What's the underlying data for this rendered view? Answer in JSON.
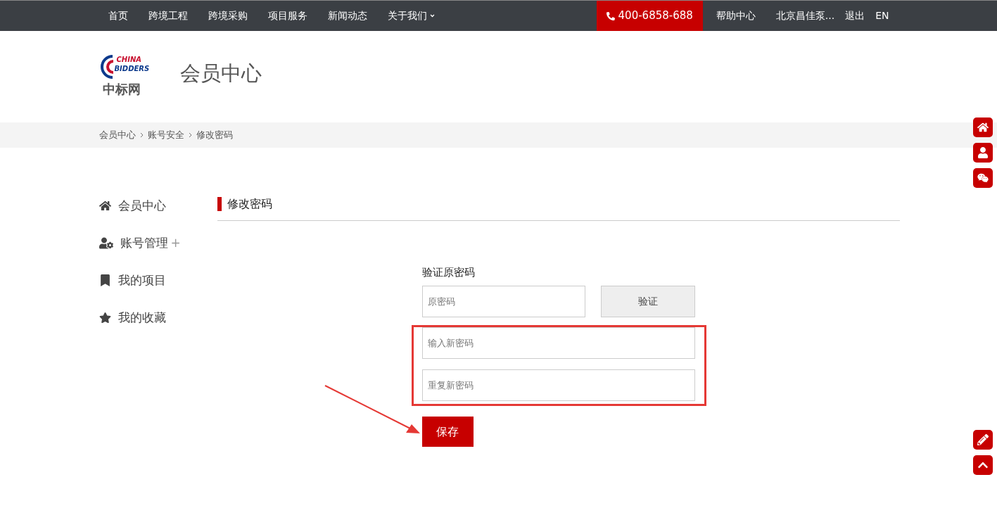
{
  "top_nav": {
    "items": [
      {
        "label": "首页",
        "dropdown": false
      },
      {
        "label": "跨境工程",
        "dropdown": false
      },
      {
        "label": "跨境采购",
        "dropdown": false
      },
      {
        "label": "项目服务",
        "dropdown": false
      },
      {
        "label": "新闻动态",
        "dropdown": false
      },
      {
        "label": "关于我们",
        "dropdown": true
      }
    ],
    "phone": "400-6858-688",
    "right_links": [
      "帮助中心",
      "北京昌佳泵...",
      "退出",
      "EN"
    ]
  },
  "header": {
    "logo": {
      "latin_top": "CHINA",
      "latin_bottom": "BIDDERS",
      "chinese": "中标网"
    },
    "title": "会员中心"
  },
  "breadcrumb": [
    "会员中心",
    "账号安全",
    "修改密码"
  ],
  "sidebar": {
    "items": [
      {
        "kind": "home",
        "label": "会员中心"
      },
      {
        "kind": "account",
        "label": "账号管理",
        "suffix": "+"
      },
      {
        "kind": "bookmark",
        "label": "我的项目"
      },
      {
        "kind": "star",
        "label": "我的收藏"
      }
    ]
  },
  "main": {
    "title": "修改密码",
    "section_label": "验证原密码",
    "old_password": {
      "placeholder": "原密码"
    },
    "verify_button": "验证",
    "new_password": {
      "placeholder": "输入新密码"
    },
    "repeat_password": {
      "placeholder": "重复新密码"
    },
    "save_button": "保存"
  },
  "float_buttons": [
    {
      "kind": "home"
    },
    {
      "kind": "user"
    },
    {
      "kind": "wechat"
    },
    {
      "kind": "edit"
    },
    {
      "kind": "top"
    }
  ]
}
